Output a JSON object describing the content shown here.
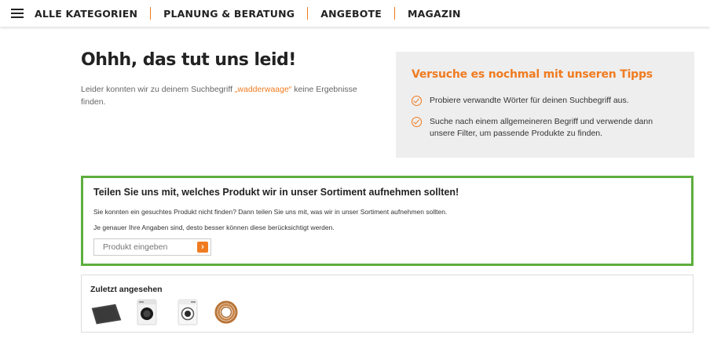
{
  "nav": {
    "items": [
      "ALLE KATEGORIEN",
      "PLANUNG & BERATUNG",
      "ANGEBOTE",
      "MAGAZIN"
    ]
  },
  "noresult": {
    "headline": "Ohhh, das tut uns leid!",
    "text_before": "Leider konnten wir zu deinem Suchbegriff ",
    "search_term": "„wadderwaage“",
    "text_after": " keine Ergebnisse finden."
  },
  "tips": {
    "title": "Versuche es nochmal mit unseren Tipps",
    "items": [
      "Probiere verwandte Wörter für deinen Suchbegriff aus.",
      "Suche nach einem allgemeineren Begriff und verwende dann unsere Filter, um passende Produkte zu finden."
    ]
  },
  "suggest": {
    "title": "Teilen Sie uns mit, welches Produkt wir in unser Sortiment aufnehmen sollten!",
    "p1": "Sie konnten ein gesuchtes Produkt nicht finden? Dann teilen Sie uns mit, was wir in unser Sortiment aufnehmen sollten.",
    "p2": "Je genauer Ihre Angaben sind, desto besser können diese berücksichtigt werden.",
    "placeholder": "Produkt eingeben",
    "submit_icon": "chevron-right-icon"
  },
  "recent": {
    "title": "Zuletzt angesehen",
    "items": [
      "dark-mat-product",
      "washing-machine-product",
      "washing-machine-product",
      "hose-ring-product"
    ]
  },
  "colors": {
    "accent": "#f07b20",
    "highlight_border": "#5dae3e",
    "tips_bg": "#eeeeee"
  }
}
